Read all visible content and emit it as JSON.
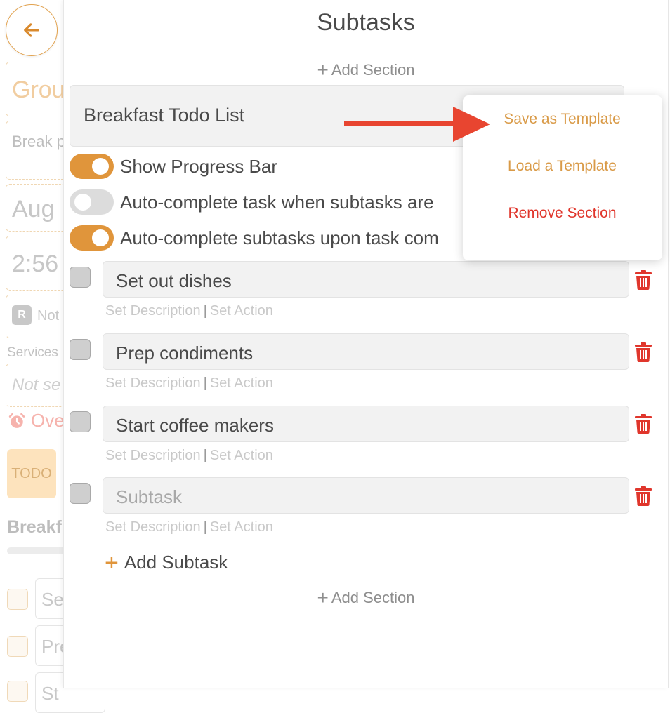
{
  "background": {
    "group_text": "Grou",
    "description_text": "Break partic",
    "date_text": "Aug",
    "time_text": "2:56",
    "note_badge": "R",
    "note_text": "Not",
    "services_label": "Services",
    "services_value": "Not se",
    "overdue_text": "Ove",
    "status_chip": "TODO",
    "section_title": "Breakf",
    "item_1": "Se",
    "item_2": "Pre",
    "item_3": "St"
  },
  "panel": {
    "title": "Subtasks",
    "add_section_label": "Add Section",
    "section_title": "Breakfast Todo List",
    "toggles": [
      {
        "label": "Show Progress Bar",
        "on": true
      },
      {
        "label": "Auto-complete task when subtasks are",
        "on": false
      },
      {
        "label": "Auto-complete subtasks upon task com",
        "on": true
      }
    ],
    "subtasks": [
      {
        "text": "Set out dishes",
        "placeholder": false
      },
      {
        "text": "Prep condiments",
        "placeholder": false
      },
      {
        "text": "Start coffee makers",
        "placeholder": false
      },
      {
        "text": "Subtask",
        "placeholder": true
      }
    ],
    "set_description_label": "Set Description",
    "separator": "|",
    "set_action_label": "Set Action",
    "add_subtask_label": "Add Subtask"
  },
  "menu": {
    "items": [
      "Save as Template",
      "Load a Template",
      "Remove Section"
    ]
  },
  "colors": {
    "accent": "#e0953b",
    "danger": "#e0362c",
    "annotation_arrow": "#e84530"
  },
  "icons": {
    "back": "arrow-left-icon",
    "trash": "trash-icon",
    "alarm": "alarm-clock-icon",
    "plus": "plus-icon"
  }
}
